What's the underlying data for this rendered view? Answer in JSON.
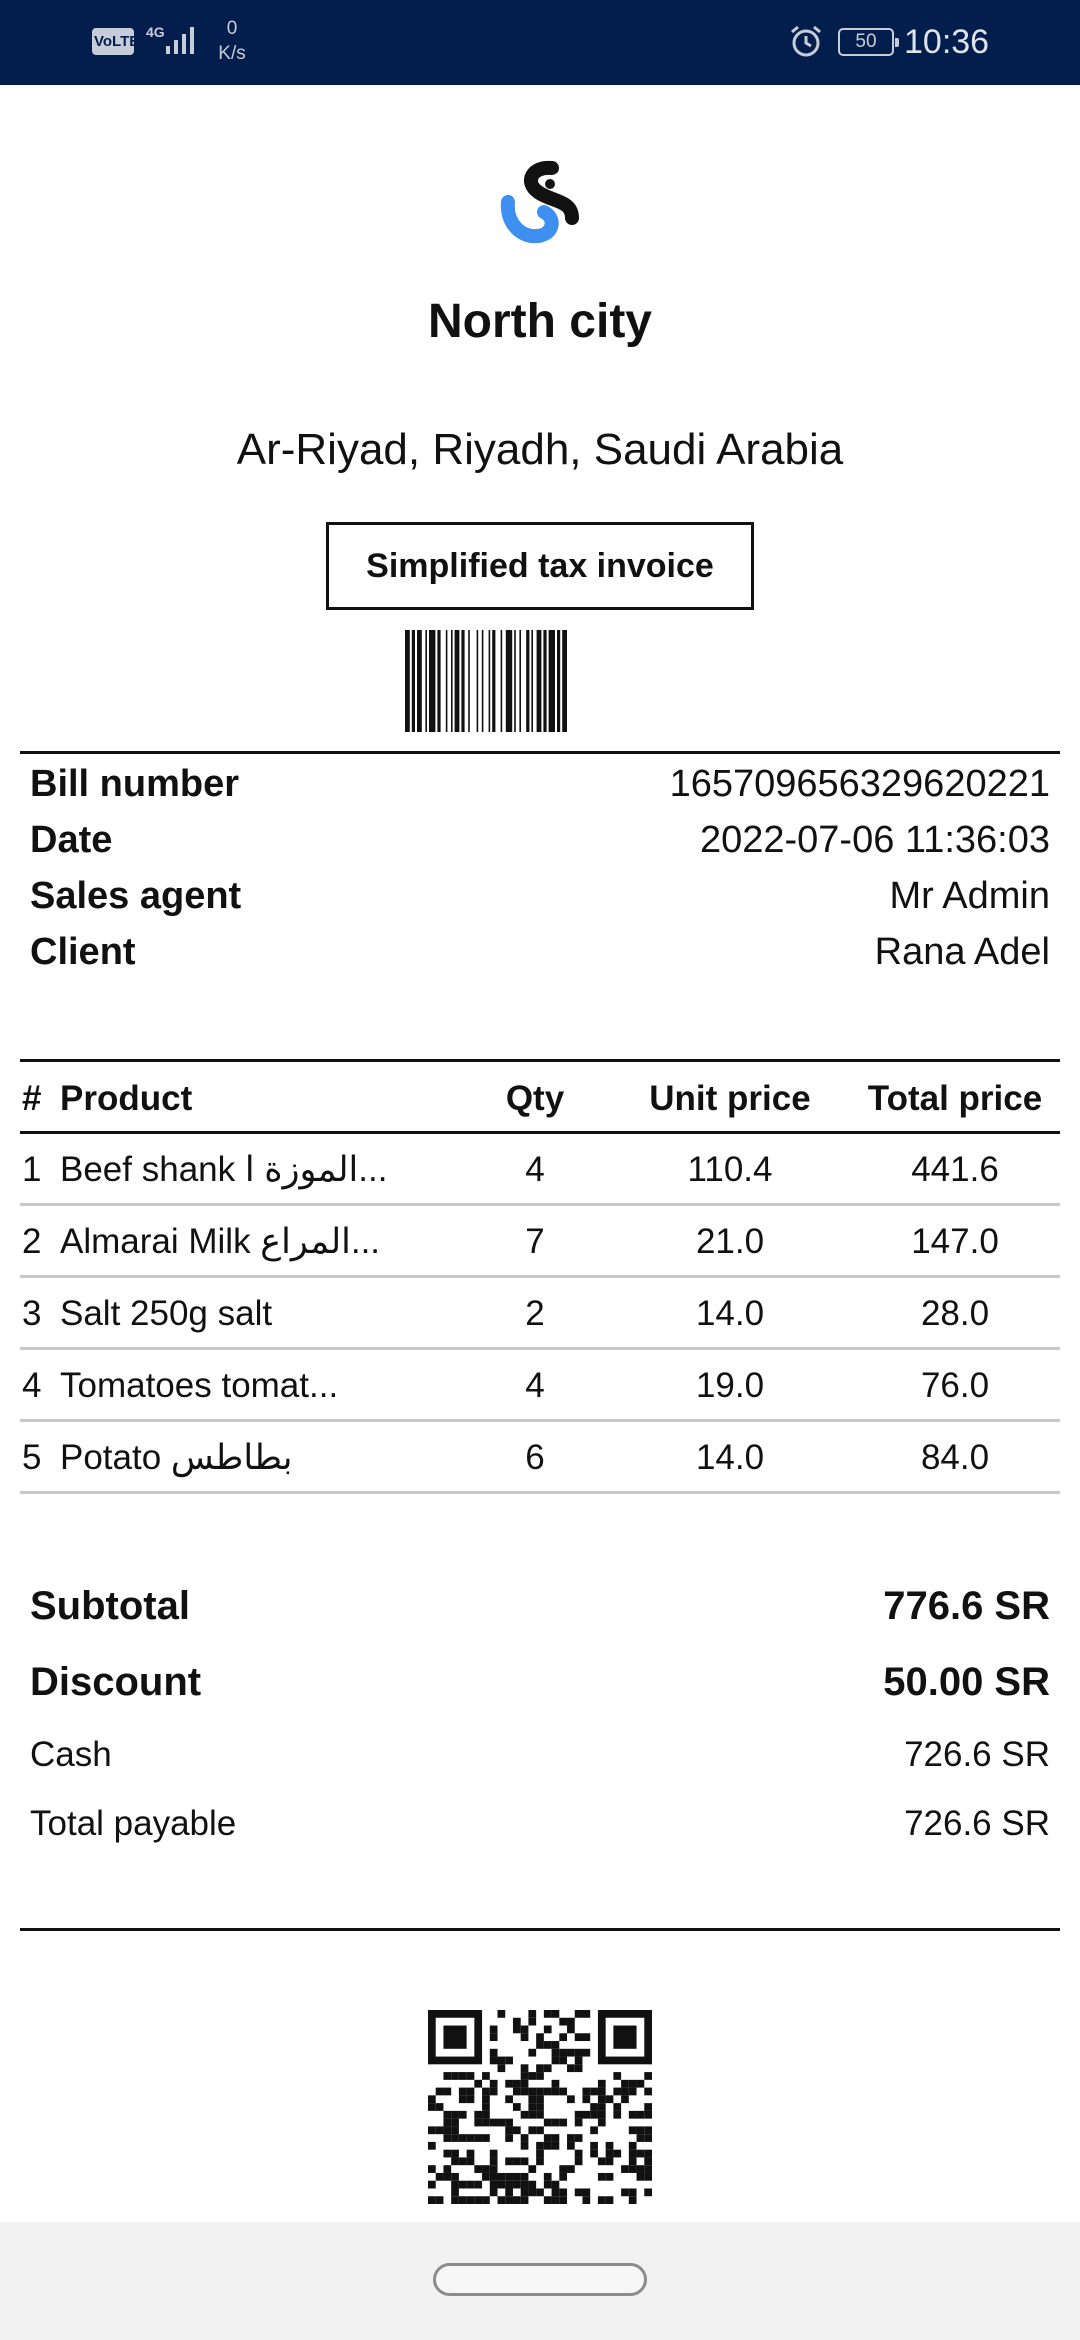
{
  "status_bar": {
    "volte": "VoLTE",
    "network": "4G",
    "speed_value": "0",
    "speed_unit": "K/s",
    "battery": "50",
    "time": "10:36"
  },
  "store": {
    "name": "North city",
    "address": "Ar-Riyad, Riyadh, Saudi Arabia",
    "invoice_type": "Simplified tax invoice"
  },
  "info": [
    {
      "label": "Bill number",
      "value": "165709656329620221"
    },
    {
      "label": "Date",
      "value": "2022-07-06 11:36:03"
    },
    {
      "label": "Sales agent",
      "value": "Mr Admin"
    },
    {
      "label": "Client",
      "value": "Rana Adel"
    }
  ],
  "table": {
    "headers": {
      "num": "#",
      "product": "Product",
      "qty": "Qty",
      "unit_price": "Unit price",
      "total_price": "Total price"
    },
    "rows": [
      {
        "num": "1",
        "product": "Beef shank الموزة ا...",
        "qty": "4",
        "unit_price": "110.4",
        "total_price": "441.6"
      },
      {
        "num": "2",
        "product": "Almarai Milk المراع...",
        "qty": "7",
        "unit_price": "21.0",
        "total_price": "147.0"
      },
      {
        "num": "3",
        "product": "Salt 250g salt",
        "qty": "2",
        "unit_price": "14.0",
        "total_price": "28.0"
      },
      {
        "num": "4",
        "product": "Tomatoes tomat...",
        "qty": "4",
        "unit_price": "19.0",
        "total_price": "76.0"
      },
      {
        "num": "5",
        "product": "Potato بطاطس",
        "qty": "6",
        "unit_price": "14.0",
        "total_price": "84.0"
      }
    ]
  },
  "totals": {
    "subtotal_label": "Subtotal",
    "subtotal_value": "776.6 SR",
    "discount_label": "Discount",
    "discount_value": "50.00 SR",
    "cash_label": "Cash",
    "cash_value": "726.6 SR",
    "payable_label": "Total payable",
    "payable_value": "726.6 SR"
  },
  "icons": {
    "logo": "brand-logo-icon",
    "alarm": "alarm-icon",
    "signal": "signal-icon",
    "barcode": "barcode",
    "qr": "qr-code"
  },
  "colors": {
    "status_bar_bg": "#031d4c",
    "logo_black": "#111111",
    "logo_blue": "#3d8ff0"
  }
}
